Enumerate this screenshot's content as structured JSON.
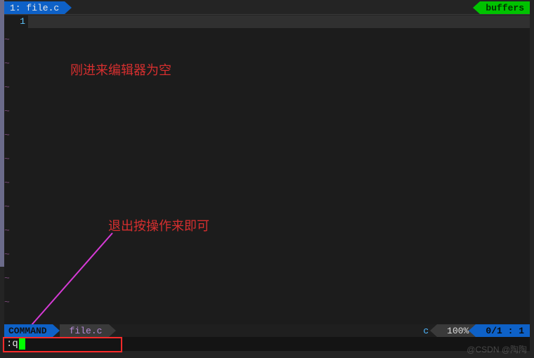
{
  "tabs": {
    "active_label": "1: file.c",
    "buffers_label": "buffers"
  },
  "editor": {
    "first_line_no": "1",
    "empty_marker": "~"
  },
  "annotations": {
    "empty_note": "刚进来编辑器为空",
    "quit_note": "退出按操作来即可"
  },
  "status": {
    "mode": "COMMAND",
    "filename": "file.c",
    "filetype": "c",
    "percent": "100%",
    "position": "0/1 :  1"
  },
  "cmdline": {
    "text": ":q"
  },
  "watermark": "@CSDN @陶陶"
}
